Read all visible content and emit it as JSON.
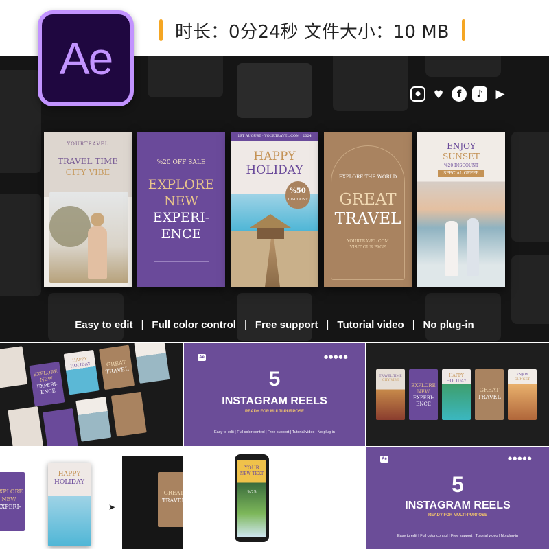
{
  "header": {
    "logo_text": "Ae",
    "meta_text": "时长：0分24秒  文件大小：10 MB"
  },
  "hero": {
    "cards": [
      {
        "brand": "YOURTRAVEL",
        "line1": "TRAVEL TIME",
        "line2": "CITY VIBE"
      },
      {
        "line0": "%20 OFF SALE",
        "line1": "EXPLORE",
        "line2": "NEW",
        "line3": "EXPERI-",
        "line4": "ENCE"
      },
      {
        "top": "1ST AUGUST · YOURTRAVEL.COM · 2024",
        "line1": "HAPPY",
        "line2": "HOLIDAY",
        "badge1": "%50",
        "badge2": "DISCOUNT"
      },
      {
        "small": "EXPLORE THE WORLD",
        "line1": "GREAT",
        "line2": "TRAVEL",
        "foot1": "YOURTRAVEL.COM",
        "foot2": "VISIT OUR PAGE"
      },
      {
        "line1": "ENJOY",
        "line2": "SUNSET",
        "small": "%20 DISCOUNT",
        "tag": "SPECIAL OFFER"
      }
    ],
    "features": [
      "Easy to edit",
      "Full color control",
      "Free support",
      "Tutorial video",
      "No plug-in"
    ]
  },
  "thumbs": {
    "reels_number": "5",
    "reels_title": "INSTAGRAM REELS",
    "reels_sub": "READY FOR MULTI-PURPOSE",
    "features_line": "Easy to edit  |  Full color control  |  Free support  |  Tutorial video  |  No plug-in",
    "ae_badge": "Ae",
    "grid_labels": [
      "EXPLORE",
      "NEW",
      "EXPERI-",
      "ENCE",
      "HAPPY",
      "HOLIDAY",
      "GREAT",
      "TRAVEL",
      "TRAVEL TIME",
      "CITY VIBE",
      "ENJOY",
      "SUNSET"
    ],
    "phone_text1": "YOUR",
    "phone_text2": "NEW TEXT",
    "phone_badge": "%25"
  },
  "colors": {
    "purple": "#6a4a9a",
    "tan": "#a98360",
    "dark": "#151515",
    "accent": "#f5a623",
    "ae_purple": "#c293ff"
  }
}
